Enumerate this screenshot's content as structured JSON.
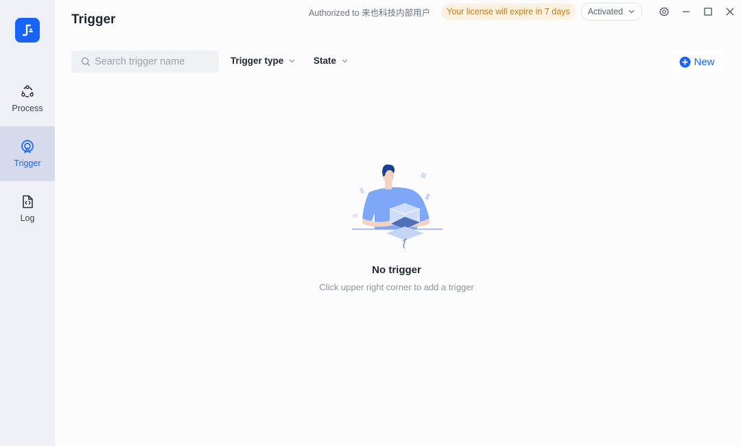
{
  "sidebar": {
    "items": [
      {
        "label": "Process",
        "icon": "process-icon"
      },
      {
        "label": "Trigger",
        "icon": "trigger-icon",
        "active": true
      },
      {
        "label": "Log",
        "icon": "log-file-icon"
      }
    ]
  },
  "header": {
    "title": "Trigger",
    "authorized_text": "Authorized to 来也科技内部用户",
    "license_notice": "Your license will expire in 7 days",
    "activation_status": "Activated"
  },
  "toolbar": {
    "search_placeholder": "Search trigger name",
    "search_value": "",
    "trigger_type_label": "Trigger type",
    "state_label": "State",
    "new_label": "New"
  },
  "empty_state": {
    "title": "No trigger",
    "subtitle": "Click upper right corner to add a trigger"
  },
  "colors": {
    "accent": "#1764f6",
    "sidebar_bg": "#eef0f5",
    "sidebar_active_bg": "#d6dbec",
    "license_text": "#c97a12",
    "license_bg": "#fdf2e2"
  }
}
